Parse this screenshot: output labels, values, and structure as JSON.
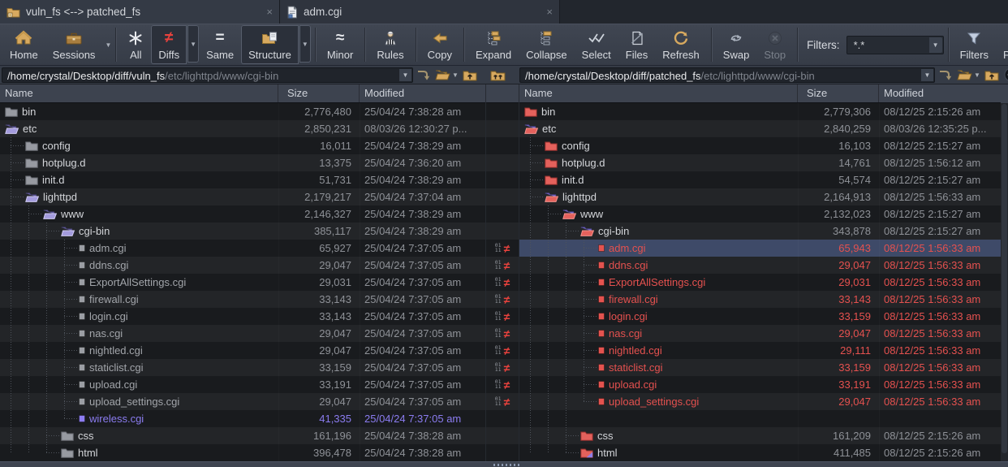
{
  "window": {
    "title": "folder/file compare session"
  },
  "tabs": [
    {
      "label": "vuln_fs <--> patched_fs",
      "icon": "folder-compare",
      "active": true
    },
    {
      "label": "adm.cgi",
      "icon": "file-compare",
      "active": false
    }
  ],
  "toolbar": {
    "groups": [
      [
        {
          "type": "button",
          "label": "Home",
          "icon": "home"
        },
        {
          "type": "button",
          "label": "Sessions",
          "icon": "sessions",
          "dropdown": "inline"
        }
      ],
      [
        {
          "type": "button",
          "label": "All",
          "icon": "all"
        },
        {
          "type": "button",
          "label": "Diffs",
          "icon": "diffs",
          "pressed": true,
          "dropdown": "box"
        },
        {
          "type": "button",
          "label": "Same",
          "icon": "same"
        },
        {
          "type": "button",
          "label": "Structure",
          "icon": "structure",
          "pressed": true,
          "dropdown": "box"
        }
      ],
      [
        {
          "type": "button",
          "label": "Minor",
          "icon": "minor"
        }
      ],
      [
        {
          "type": "button",
          "label": "Rules",
          "icon": "rules"
        }
      ],
      [
        {
          "type": "button",
          "label": "Copy",
          "icon": "copy"
        }
      ],
      [
        {
          "type": "button",
          "label": "Expand",
          "icon": "expand"
        },
        {
          "type": "button",
          "label": "Collapse",
          "icon": "collapse"
        },
        {
          "type": "button",
          "label": "Select",
          "icon": "select"
        },
        {
          "type": "button",
          "label": "Files",
          "icon": "files"
        },
        {
          "type": "button",
          "label": "Refresh",
          "icon": "refresh"
        }
      ],
      [
        {
          "type": "button",
          "label": "Swap",
          "icon": "swap"
        },
        {
          "type": "button",
          "label": "Stop",
          "icon": "stop",
          "disabled": true
        }
      ],
      [
        {
          "type": "label",
          "label": "Filters:"
        },
        {
          "type": "combo",
          "value": "*.*"
        }
      ],
      [
        {
          "type": "button",
          "label": "Filters",
          "icon": "filter"
        },
        {
          "type": "button",
          "label": "Peek",
          "icon": "peek"
        }
      ]
    ]
  },
  "paths": {
    "left": {
      "base": "/home/crystal/Desktop/diff/vuln_fs",
      "rest": "/etc/lighttpd/www/cgi-bin"
    },
    "right": {
      "base": "/home/crystal/Desktop/diff/patched_fs",
      "rest": "/etc/lighttpd/www/cgi-bin"
    }
  },
  "columns": [
    "Name",
    "Size",
    "Modified"
  ],
  "colors": {
    "diff_red": "#e5514f",
    "orphan_purple": "#8b7cf0",
    "selection_blue": "#3e4a68",
    "accent_tan": "#d7a95f",
    "not_equal_red": "#e8423d"
  },
  "rows": [
    {
      "lvl": 0,
      "diff": false,
      "sel": false,
      "l": {
        "i": "fg",
        "n": "bin",
        "s": "2,776,480",
        "m": "25/04/24 7:38:28 am",
        "st": "norm"
      },
      "r": {
        "i": "fr",
        "n": "bin",
        "s": "2,779,306",
        "m": "08/12/25 2:15:26 am",
        "st": "norm"
      }
    },
    {
      "lvl": 0,
      "diff": false,
      "sel": false,
      "l": {
        "i": "fop",
        "n": "etc",
        "s": "2,850,231",
        "m": "08/03/26 12:30:27 p...",
        "st": "norm"
      },
      "r": {
        "i": "forp",
        "n": "etc",
        "s": "2,840,259",
        "m": "08/03/26 12:35:25 p...",
        "st": "norm"
      }
    },
    {
      "lvl": 1,
      "diff": false,
      "sel": false,
      "l": {
        "i": "fg",
        "n": "config",
        "s": "16,011",
        "m": "25/04/24 7:38:29 am",
        "st": "norm"
      },
      "r": {
        "i": "fr",
        "n": "config",
        "s": "16,103",
        "m": "08/12/25 2:15:27 am",
        "st": "norm"
      }
    },
    {
      "lvl": 1,
      "diff": false,
      "sel": false,
      "l": {
        "i": "fg",
        "n": "hotplug.d",
        "s": "13,375",
        "m": "25/04/24 7:36:20 am",
        "st": "norm"
      },
      "r": {
        "i": "fr",
        "n": "hotplug.d",
        "s": "14,761",
        "m": "08/12/25 1:56:12 am",
        "st": "norm"
      }
    },
    {
      "lvl": 1,
      "diff": false,
      "sel": false,
      "l": {
        "i": "fg",
        "n": "init.d",
        "s": "51,731",
        "m": "25/04/24 7:38:29 am",
        "st": "norm"
      },
      "r": {
        "i": "fr",
        "n": "init.d",
        "s": "54,574",
        "m": "08/12/25 2:15:27 am",
        "st": "norm"
      }
    },
    {
      "lvl": 1,
      "diff": false,
      "sel": false,
      "l": {
        "i": "fop",
        "n": "lighttpd",
        "s": "2,179,217",
        "m": "25/04/24 7:37:04 am",
        "st": "norm"
      },
      "r": {
        "i": "forp",
        "n": "lighttpd",
        "s": "2,164,913",
        "m": "08/12/25 1:56:33 am",
        "st": "norm"
      }
    },
    {
      "lvl": 2,
      "diff": false,
      "sel": false,
      "l": {
        "i": "fop",
        "n": "www",
        "s": "2,146,327",
        "m": "25/04/24 7:38:29 am",
        "st": "norm"
      },
      "r": {
        "i": "forp",
        "n": "www",
        "s": "2,132,023",
        "m": "08/12/25 2:15:27 am",
        "st": "norm"
      }
    },
    {
      "lvl": 3,
      "diff": false,
      "sel": false,
      "l": {
        "i": "fop",
        "n": "cgi-bin",
        "s": "385,117",
        "m": "25/04/24 7:38:29 am",
        "st": "norm"
      },
      "r": {
        "i": "forp",
        "n": "cgi-bin",
        "s": "343,878",
        "m": "08/12/25 2:15:27 am",
        "st": "norm"
      }
    },
    {
      "lvl": 4,
      "diff": true,
      "sel": true,
      "l": {
        "i": "dg",
        "n": "adm.cgi",
        "s": "65,927",
        "m": "25/04/24 7:37:05 am",
        "st": "dim"
      },
      "r": {
        "i": "dr",
        "n": "adm.cgi",
        "s": "65,943",
        "m": "08/12/25 1:56:33 am",
        "st": "red"
      }
    },
    {
      "lvl": 4,
      "diff": true,
      "sel": false,
      "l": {
        "i": "dg",
        "n": "ddns.cgi",
        "s": "29,047",
        "m": "25/04/24 7:37:05 am",
        "st": "dim"
      },
      "r": {
        "i": "dr",
        "n": "ddns.cgi",
        "s": "29,047",
        "m": "08/12/25 1:56:33 am",
        "st": "red"
      }
    },
    {
      "lvl": 4,
      "diff": true,
      "sel": false,
      "l": {
        "i": "dg",
        "n": "ExportAllSettings.cgi",
        "s": "29,031",
        "m": "25/04/24 7:37:05 am",
        "st": "dim"
      },
      "r": {
        "i": "dr",
        "n": "ExportAllSettings.cgi",
        "s": "29,031",
        "m": "08/12/25 1:56:33 am",
        "st": "red"
      }
    },
    {
      "lvl": 4,
      "diff": true,
      "sel": false,
      "l": {
        "i": "dg",
        "n": "firewall.cgi",
        "s": "33,143",
        "m": "25/04/24 7:37:05 am",
        "st": "dim"
      },
      "r": {
        "i": "dr",
        "n": "firewall.cgi",
        "s": "33,143",
        "m": "08/12/25 1:56:33 am",
        "st": "red"
      }
    },
    {
      "lvl": 4,
      "diff": true,
      "sel": false,
      "l": {
        "i": "dg",
        "n": "login.cgi",
        "s": "33,143",
        "m": "25/04/24 7:37:05 am",
        "st": "dim"
      },
      "r": {
        "i": "dr",
        "n": "login.cgi",
        "s": "33,159",
        "m": "08/12/25 1:56:33 am",
        "st": "red"
      }
    },
    {
      "lvl": 4,
      "diff": true,
      "sel": false,
      "l": {
        "i": "dg",
        "n": "nas.cgi",
        "s": "29,047",
        "m": "25/04/24 7:37:05 am",
        "st": "dim"
      },
      "r": {
        "i": "dr",
        "n": "nas.cgi",
        "s": "29,047",
        "m": "08/12/25 1:56:33 am",
        "st": "red"
      }
    },
    {
      "lvl": 4,
      "diff": true,
      "sel": false,
      "l": {
        "i": "dg",
        "n": "nightled.cgi",
        "s": "29,047",
        "m": "25/04/24 7:37:05 am",
        "st": "dim"
      },
      "r": {
        "i": "dr",
        "n": "nightled.cgi",
        "s": "29,111",
        "m": "08/12/25 1:56:33 am",
        "st": "red"
      }
    },
    {
      "lvl": 4,
      "diff": true,
      "sel": false,
      "l": {
        "i": "dg",
        "n": "staticlist.cgi",
        "s": "33,159",
        "m": "25/04/24 7:37:05 am",
        "st": "dim"
      },
      "r": {
        "i": "dr",
        "n": "staticlist.cgi",
        "s": "33,159",
        "m": "08/12/25 1:56:33 am",
        "st": "red"
      }
    },
    {
      "lvl": 4,
      "diff": true,
      "sel": false,
      "l": {
        "i": "dg",
        "n": "upload.cgi",
        "s": "33,191",
        "m": "25/04/24 7:37:05 am",
        "st": "dim"
      },
      "r": {
        "i": "dr",
        "n": "upload.cgi",
        "s": "33,191",
        "m": "08/12/25 1:56:33 am",
        "st": "red"
      }
    },
    {
      "lvl": 4,
      "diff": true,
      "sel": false,
      "l": {
        "i": "dg",
        "n": "upload_settings.cgi",
        "s": "29,047",
        "m": "25/04/24 7:37:05 am",
        "st": "dim"
      },
      "r": {
        "i": "dr",
        "n": "upload_settings.cgi",
        "s": "29,047",
        "m": "08/12/25 1:56:33 am",
        "st": "red"
      }
    },
    {
      "lvl": 4,
      "diff": false,
      "sel": false,
      "l": {
        "i": "dp",
        "n": "wireless.cgi",
        "s": "41,335",
        "m": "25/04/24 7:37:05 am",
        "st": "purple"
      },
      "r": null
    },
    {
      "lvl": 3,
      "diff": false,
      "sel": false,
      "l": {
        "i": "fg",
        "n": "css",
        "s": "161,196",
        "m": "25/04/24 7:38:28 am",
        "st": "norm"
      },
      "r": {
        "i": "fr",
        "n": "css",
        "s": "161,209",
        "m": "08/12/25 2:15:26 am",
        "st": "norm"
      }
    },
    {
      "lvl": 3,
      "diff": false,
      "sel": false,
      "l": {
        "i": "fg",
        "n": "html",
        "s": "396,478",
        "m": "25/04/24 7:38:28 am",
        "st": "norm"
      },
      "r": {
        "i": "frp",
        "n": "html",
        "s": "411,485",
        "m": "08/12/25 2:15:26 am",
        "st": "norm"
      }
    }
  ]
}
